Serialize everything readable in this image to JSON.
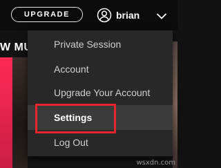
{
  "topbar": {
    "upgrade_label": "UPGRADE",
    "username": "brian",
    "user_icon": "user-circle-icon",
    "menu_toggle_icon": "chevron-down-icon"
  },
  "background": {
    "section_title": "W MU"
  },
  "menu": {
    "items": [
      {
        "label": "Private Session"
      },
      {
        "label": "Account"
      },
      {
        "label": "Upgrade Your Account"
      },
      {
        "label": "Settings",
        "highlighted": true
      },
      {
        "label": "Log Out"
      }
    ]
  },
  "watermark": "wsxdn.com",
  "colors": {
    "menu_bg": "#282828",
    "highlight_border": "#e8262b",
    "active_item_bg": "#3b3b3b"
  }
}
